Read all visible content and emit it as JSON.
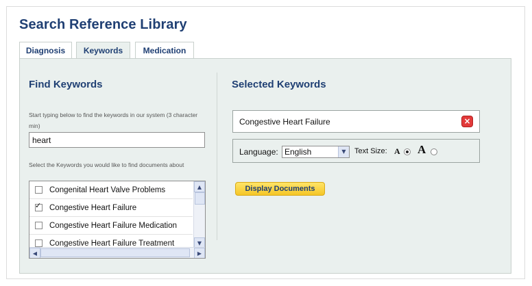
{
  "page_title": "Search Reference Library",
  "tabs": [
    {
      "label": "Diagnosis"
    },
    {
      "label": "Keywords"
    },
    {
      "label": "Medication"
    }
  ],
  "find": {
    "heading": "Find Keywords",
    "hint": "Start typing below to find the keywords in our system (3 character min)",
    "search_value": "heart",
    "select_hint": "Select the Keywords you would like to find documents about",
    "items": [
      {
        "label": "Congenital Heart Valve Problems",
        "checked": false
      },
      {
        "label": "Congestive Heart Failure",
        "checked": true
      },
      {
        "label": "Congestive Heart Failure Medication",
        "checked": false
      },
      {
        "label": "Congestive Heart Failure Treatment",
        "checked": false
      }
    ]
  },
  "selected": {
    "heading": "Selected Keywords",
    "keywords": [
      {
        "label": "Congestive Heart Failure"
      }
    ],
    "language_label": "Language:",
    "language_value": "English",
    "text_size_label": "Text Size:",
    "text_size_small": "A",
    "text_size_large": "A",
    "display_button": "Display Documents"
  },
  "colors": {
    "heading": "#1f3f73",
    "panel_bg": "#eaf0ee",
    "remove": "#e23a3a",
    "button": "#f5c627"
  }
}
